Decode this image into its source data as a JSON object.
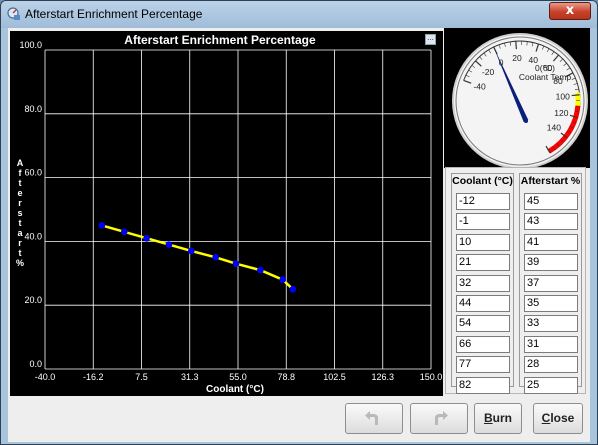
{
  "window": {
    "title": "Afterstart Enrichment Percentage",
    "close_glyph": "x"
  },
  "chart_menu_glyph": "...",
  "chart_data": {
    "type": "line",
    "title": "Afterstart Enrichment Percentage",
    "xlabel": "Coolant (°C)",
    "ylabel": "Afterstart %",
    "x_ticks": [
      "-40.0",
      "-16.2",
      "7.5",
      "31.3",
      "55.0",
      "78.8",
      "102.5",
      "126.3",
      "150.0"
    ],
    "y_ticks": [
      "0.0",
      "20.0",
      "40.0",
      "60.0",
      "80.0",
      "100.0"
    ],
    "xlim": [
      -40,
      150
    ],
    "ylim": [
      0,
      100
    ],
    "grid": true,
    "series": [
      {
        "x": [
          -12,
          -1,
          10,
          21,
          32,
          44,
          54,
          66,
          77,
          82
        ],
        "y": [
          45,
          43,
          41,
          39,
          37,
          35,
          33,
          31,
          28,
          25
        ]
      }
    ],
    "line_color": "#ffff00",
    "point_color": "#0000ff"
  },
  "gauge": {
    "label_unit": "0(°C)",
    "label_name": "Coolant Temp",
    "value": 0,
    "min": -40,
    "max": 160,
    "tick_labels": [
      "-40",
      "-20",
      "0",
      "20",
      "40",
      "60",
      "80",
      "100",
      "120",
      "140"
    ],
    "warn_color": "#ffff00",
    "danger_color": "#ff0000"
  },
  "table": {
    "col1_header": "Coolant (°C)",
    "col2_header": "Afterstart %",
    "rows": [
      {
        "coolant": "-12",
        "pct": "45"
      },
      {
        "coolant": "-1",
        "pct": "43"
      },
      {
        "coolant": "10",
        "pct": "41"
      },
      {
        "coolant": "21",
        "pct": "39"
      },
      {
        "coolant": "32",
        "pct": "37"
      },
      {
        "coolant": "44",
        "pct": "35"
      },
      {
        "coolant": "54",
        "pct": "33"
      },
      {
        "coolant": "66",
        "pct": "31"
      },
      {
        "coolant": "77",
        "pct": "28"
      },
      {
        "coolant": "82",
        "pct": "25"
      }
    ]
  },
  "buttons": {
    "undo_icon": "undo-icon",
    "redo_icon": "redo-icon",
    "burn_mnemonic": "B",
    "burn_rest": "urn",
    "close_mnemonic": "C",
    "close_rest": "lose"
  }
}
